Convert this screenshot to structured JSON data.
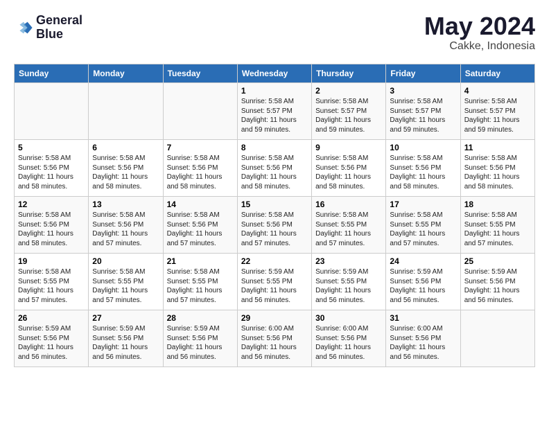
{
  "header": {
    "logo_line1": "General",
    "logo_line2": "Blue",
    "month": "May 2024",
    "location": "Cakke, Indonesia"
  },
  "days_of_week": [
    "Sunday",
    "Monday",
    "Tuesday",
    "Wednesday",
    "Thursday",
    "Friday",
    "Saturday"
  ],
  "weeks": [
    [
      {
        "day": "",
        "info": ""
      },
      {
        "day": "",
        "info": ""
      },
      {
        "day": "",
        "info": ""
      },
      {
        "day": "1",
        "info": "Sunrise: 5:58 AM\nSunset: 5:57 PM\nDaylight: 11 hours\nand 59 minutes."
      },
      {
        "day": "2",
        "info": "Sunrise: 5:58 AM\nSunset: 5:57 PM\nDaylight: 11 hours\nand 59 minutes."
      },
      {
        "day": "3",
        "info": "Sunrise: 5:58 AM\nSunset: 5:57 PM\nDaylight: 11 hours\nand 59 minutes."
      },
      {
        "day": "4",
        "info": "Sunrise: 5:58 AM\nSunset: 5:57 PM\nDaylight: 11 hours\nand 59 minutes."
      }
    ],
    [
      {
        "day": "5",
        "info": "Sunrise: 5:58 AM\nSunset: 5:56 PM\nDaylight: 11 hours\nand 58 minutes."
      },
      {
        "day": "6",
        "info": "Sunrise: 5:58 AM\nSunset: 5:56 PM\nDaylight: 11 hours\nand 58 minutes."
      },
      {
        "day": "7",
        "info": "Sunrise: 5:58 AM\nSunset: 5:56 PM\nDaylight: 11 hours\nand 58 minutes."
      },
      {
        "day": "8",
        "info": "Sunrise: 5:58 AM\nSunset: 5:56 PM\nDaylight: 11 hours\nand 58 minutes."
      },
      {
        "day": "9",
        "info": "Sunrise: 5:58 AM\nSunset: 5:56 PM\nDaylight: 11 hours\nand 58 minutes."
      },
      {
        "day": "10",
        "info": "Sunrise: 5:58 AM\nSunset: 5:56 PM\nDaylight: 11 hours\nand 58 minutes."
      },
      {
        "day": "11",
        "info": "Sunrise: 5:58 AM\nSunset: 5:56 PM\nDaylight: 11 hours\nand 58 minutes."
      }
    ],
    [
      {
        "day": "12",
        "info": "Sunrise: 5:58 AM\nSunset: 5:56 PM\nDaylight: 11 hours\nand 58 minutes."
      },
      {
        "day": "13",
        "info": "Sunrise: 5:58 AM\nSunset: 5:56 PM\nDaylight: 11 hours\nand 57 minutes."
      },
      {
        "day": "14",
        "info": "Sunrise: 5:58 AM\nSunset: 5:56 PM\nDaylight: 11 hours\nand 57 minutes."
      },
      {
        "day": "15",
        "info": "Sunrise: 5:58 AM\nSunset: 5:56 PM\nDaylight: 11 hours\nand 57 minutes."
      },
      {
        "day": "16",
        "info": "Sunrise: 5:58 AM\nSunset: 5:55 PM\nDaylight: 11 hours\nand 57 minutes."
      },
      {
        "day": "17",
        "info": "Sunrise: 5:58 AM\nSunset: 5:55 PM\nDaylight: 11 hours\nand 57 minutes."
      },
      {
        "day": "18",
        "info": "Sunrise: 5:58 AM\nSunset: 5:55 PM\nDaylight: 11 hours\nand 57 minutes."
      }
    ],
    [
      {
        "day": "19",
        "info": "Sunrise: 5:58 AM\nSunset: 5:55 PM\nDaylight: 11 hours\nand 57 minutes."
      },
      {
        "day": "20",
        "info": "Sunrise: 5:58 AM\nSunset: 5:55 PM\nDaylight: 11 hours\nand 57 minutes."
      },
      {
        "day": "21",
        "info": "Sunrise: 5:58 AM\nSunset: 5:55 PM\nDaylight: 11 hours\nand 57 minutes."
      },
      {
        "day": "22",
        "info": "Sunrise: 5:59 AM\nSunset: 5:55 PM\nDaylight: 11 hours\nand 56 minutes."
      },
      {
        "day": "23",
        "info": "Sunrise: 5:59 AM\nSunset: 5:55 PM\nDaylight: 11 hours\nand 56 minutes."
      },
      {
        "day": "24",
        "info": "Sunrise: 5:59 AM\nSunset: 5:56 PM\nDaylight: 11 hours\nand 56 minutes."
      },
      {
        "day": "25",
        "info": "Sunrise: 5:59 AM\nSunset: 5:56 PM\nDaylight: 11 hours\nand 56 minutes."
      }
    ],
    [
      {
        "day": "26",
        "info": "Sunrise: 5:59 AM\nSunset: 5:56 PM\nDaylight: 11 hours\nand 56 minutes."
      },
      {
        "day": "27",
        "info": "Sunrise: 5:59 AM\nSunset: 5:56 PM\nDaylight: 11 hours\nand 56 minutes."
      },
      {
        "day": "28",
        "info": "Sunrise: 5:59 AM\nSunset: 5:56 PM\nDaylight: 11 hours\nand 56 minutes."
      },
      {
        "day": "29",
        "info": "Sunrise: 6:00 AM\nSunset: 5:56 PM\nDaylight: 11 hours\nand 56 minutes."
      },
      {
        "day": "30",
        "info": "Sunrise: 6:00 AM\nSunset: 5:56 PM\nDaylight: 11 hours\nand 56 minutes."
      },
      {
        "day": "31",
        "info": "Sunrise: 6:00 AM\nSunset: 5:56 PM\nDaylight: 11 hours\nand 56 minutes."
      },
      {
        "day": "",
        "info": ""
      }
    ]
  ]
}
